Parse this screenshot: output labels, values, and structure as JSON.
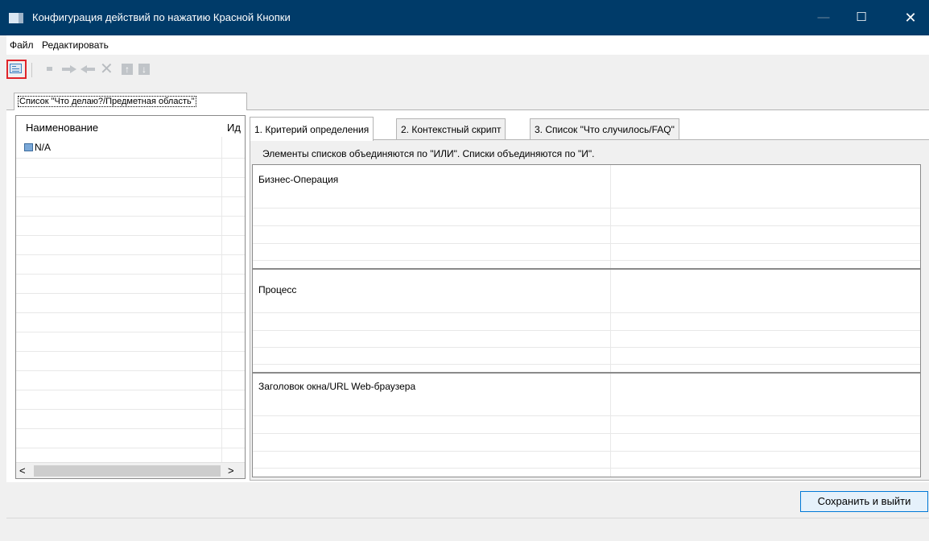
{
  "window": {
    "title": "Конфигурация действий по нажатию Красной Кнопки",
    "minimize_glyph": "—",
    "maximize_glyph": "☐",
    "close_glyph": "✕"
  },
  "menu": {
    "file": "Файл",
    "edit": "Редактировать"
  },
  "toolbar": {
    "icons": [
      "form-icon",
      "stop-icon",
      "forward-icon",
      "back-icon",
      "delete-icon",
      "move-up-icon",
      "move-down-icon"
    ],
    "delete_glyph": "✕",
    "up_glyph": "↑",
    "down_glyph": "↓"
  },
  "left_tab": {
    "label": "Список \"Что делаю?/Предметная область\""
  },
  "list": {
    "columns": [
      "Наименование",
      "Ид"
    ],
    "items": [
      "N/A"
    ],
    "scroll_left": "<",
    "scroll_right": ">"
  },
  "tabs": [
    {
      "label": "1. Критерий определения"
    },
    {
      "label": "2. Контекстный скрипт"
    },
    {
      "label": "3. Список \"Что случилось/FAQ\""
    }
  ],
  "criteria": {
    "hint": "Элементы списков объединяются по \"ИЛИ\".  Списки объединяются по \"И\".",
    "sections": [
      "Бизнес-Операция",
      "Процесс",
      "Заголовок окна/URL Web-браузера"
    ]
  },
  "footer": {
    "save_label": "Сохранить и выйти"
  },
  "colors": {
    "title_bar": "#003b69",
    "highlight": "#e0242a",
    "button_border": "#0078d7"
  }
}
